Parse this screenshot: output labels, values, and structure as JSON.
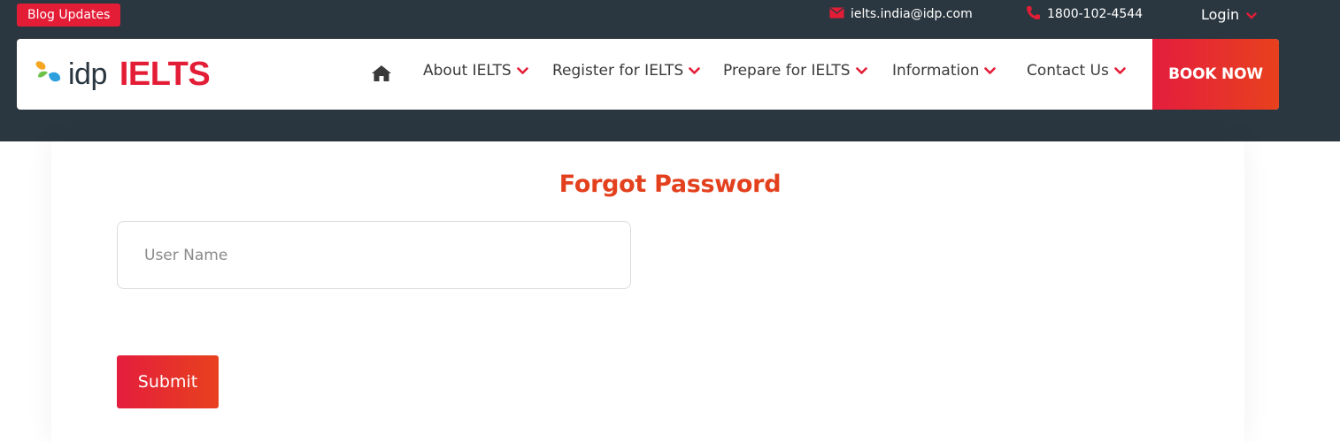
{
  "topbar": {
    "blog_badge": "Blog Updates",
    "email": "ielts.india@idp.com",
    "phone": "1800-102-4544",
    "login": "Login"
  },
  "logo": {
    "idp": "idp",
    "ielts": "IELTS"
  },
  "nav": {
    "items": [
      {
        "label": "About IELTS"
      },
      {
        "label": "Register for IELTS"
      },
      {
        "label": "Prepare for IELTS"
      },
      {
        "label": "Information"
      },
      {
        "label": "Contact Us"
      }
    ],
    "book_now": "BOOK NOW"
  },
  "form": {
    "title": "Forgot Password",
    "username_placeholder": "User Name",
    "username_value": "",
    "submit_label": "Submit"
  },
  "colors": {
    "brand_red": "#e41d37",
    "title_orange": "#e3411e",
    "topbar_bg": "#2b3740"
  },
  "icons": {
    "email": "envelope-icon",
    "phone": "phone-icon",
    "home": "home-icon",
    "dropdown": "chevron-down-icon"
  }
}
